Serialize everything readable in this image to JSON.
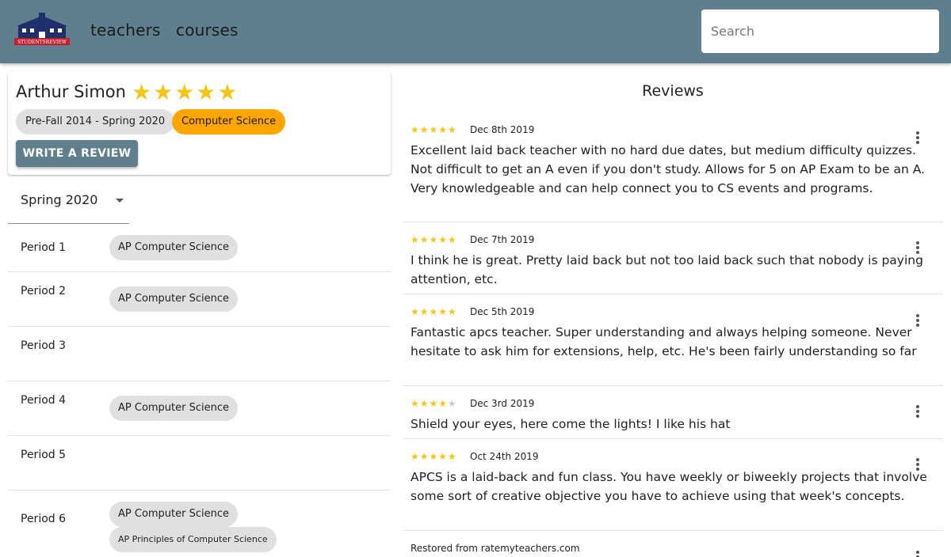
{
  "header": {
    "logo_text": "STUDENTSREVIEW",
    "nav": {
      "teachers": "teachers",
      "courses": "courses"
    },
    "search_placeholder": "Search",
    "color": "#5f7e8e"
  },
  "teacher": {
    "name": "Arthur Simon",
    "rating": 5,
    "stars": "★★★★★",
    "years_chip": "Pre-Fall 2014 - Spring 2020",
    "subject_chip": "Computer Science",
    "write_review_label": "WRITE A REVIEW"
  },
  "semester_select": {
    "value": "Spring 2020"
  },
  "periods": [
    {
      "label": "Period 1",
      "courses": [
        "AP Computer Science"
      ]
    },
    {
      "label": "Period 2",
      "courses": [
        "AP Computer Science"
      ]
    },
    {
      "label": "Period 3",
      "courses": []
    },
    {
      "label": "Period 4",
      "courses": [
        "AP Computer Science"
      ]
    },
    {
      "label": "Period 5",
      "courses": []
    },
    {
      "label": "Period 6",
      "courses": [
        "AP Computer Science",
        "AP Principles of Computer Science"
      ]
    }
  ],
  "reviews_title": "Reviews",
  "reviews": [
    {
      "rating": 5,
      "stars_on": "★★★★★",
      "stars_off": "",
      "date": "Dec 8th 2019",
      "text": "Excellent laid back teacher with no hard due dates, but medium difficulty quizzes. Not difficult to get an A even if you don't study. Allows for 5 on AP Exam to be an A. Very knowledgeable and can help connect you to CS events and programs."
    },
    {
      "rating": 5,
      "stars_on": "★★★★★",
      "stars_off": "",
      "date": "Dec 7th 2019",
      "text": "I think he is great. Pretty laid back but not too laid back such that nobody is paying attention, etc."
    },
    {
      "rating": 5,
      "stars_on": "★★★★★",
      "stars_off": "",
      "date": "Dec 5th 2019",
      "text": "Fantastic apcs teacher. Super understanding and always helping someone. Never hesitate to ask him for extensions, help, etc. He's been fairly understanding so far"
    },
    {
      "rating": 4,
      "stars_on": "★★★★",
      "stars_off": "★",
      "date": "Dec 3rd 2019",
      "text": "Shield your eyes, here come the lights! I like his hat"
    },
    {
      "rating": 5,
      "stars_on": "★★★★★",
      "stars_off": "",
      "date": "Oct 24th 2019",
      "text": "APCS is a laid-back and fun class. You have weekly or biweekly projects that involve some sort of creative objective you have to achieve using that week's concepts."
    }
  ],
  "restored_note": "Restored from ratemyteachers.com",
  "colors": {
    "accent": "#5f7e8e",
    "star": "#f5c518",
    "orange_chip": "#ffa500",
    "chip_grey": "#e0e0e0"
  }
}
